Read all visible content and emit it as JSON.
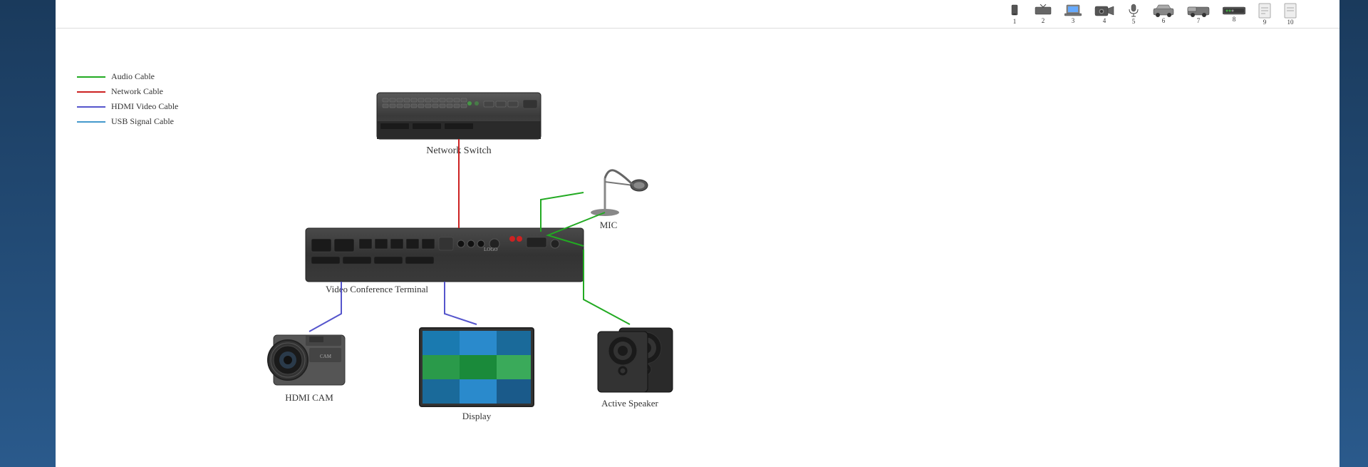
{
  "legend": {
    "items": [
      {
        "id": "audio-cable",
        "label": "Audio Cable",
        "color": "#22aa22"
      },
      {
        "id": "network-cable",
        "label": "Network Cable",
        "color": "#cc2222"
      },
      {
        "id": "hdmi-cable",
        "label": "HDMI Video Cable",
        "color": "#5555cc"
      },
      {
        "id": "usb-cable",
        "label": "USB Signal Cable",
        "color": "#4499cc"
      }
    ]
  },
  "devices": {
    "network_switch": {
      "label": "Network Switch"
    },
    "mic": {
      "label": "MIC"
    },
    "vct": {
      "label": "Video Conference Terminal"
    },
    "cam": {
      "label": "HDMI CAM"
    },
    "display": {
      "label": "Display"
    },
    "speaker": {
      "label": "Active Speaker"
    }
  },
  "top_bar": {
    "icons": [
      {
        "number": "1"
      },
      {
        "number": "2"
      },
      {
        "number": "3"
      },
      {
        "number": "4"
      },
      {
        "number": "5"
      },
      {
        "number": "6"
      },
      {
        "number": "7"
      },
      {
        "number": "8"
      },
      {
        "number": "9"
      },
      {
        "number": "10"
      }
    ]
  }
}
